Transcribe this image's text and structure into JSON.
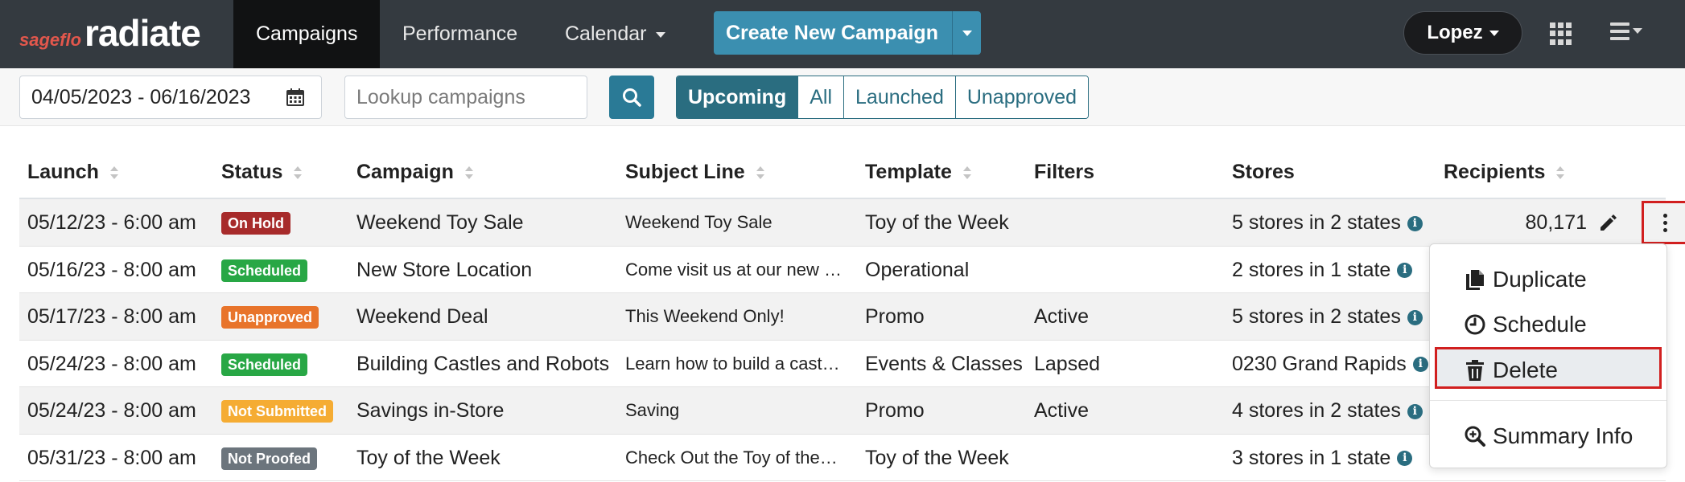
{
  "brand": {
    "small": "sageflo",
    "big": "radiate"
  },
  "nav": {
    "campaigns": "Campaigns",
    "performance": "Performance",
    "calendar": "Calendar",
    "create": "Create New Campaign",
    "user": "Lopez"
  },
  "toolbar": {
    "date_range": "04/05/2023 - 06/16/2023",
    "search_placeholder": "Lookup campaigns",
    "filters": [
      "Upcoming",
      "All",
      "Launched",
      "Unapproved"
    ],
    "active_filter": "Upcoming"
  },
  "table": {
    "headers": {
      "launch": "Launch",
      "status": "Status",
      "campaign": "Campaign",
      "subject": "Subject Line",
      "template": "Template",
      "filters": "Filters",
      "stores": "Stores",
      "recipients": "Recipients"
    },
    "rows": [
      {
        "launch": "05/12/23 - 6:00 am",
        "status": "On Hold",
        "status_color": "#a72b2b",
        "campaign": "Weekend Toy Sale",
        "subject": "Weekend Toy Sale",
        "template": "Toy of the Week",
        "filters": "",
        "stores": "5 stores in 2 states",
        "recipients": "80,171"
      },
      {
        "launch": "05/16/23 - 8:00 am",
        "status": "Scheduled",
        "status_color": "#28a745",
        "campaign": "New Store Location",
        "subject": "Come visit us at our new …",
        "template": "Operational",
        "filters": "",
        "stores": "2 stores in 1 state",
        "recipients": ""
      },
      {
        "launch": "05/17/23 - 8:00 am",
        "status": "Unapproved",
        "status_color": "#e8742b",
        "campaign": "Weekend Deal",
        "subject": "This Weekend Only!",
        "template": "Promo",
        "filters": "Active",
        "stores": "5 stores in 2 states",
        "recipients": ""
      },
      {
        "launch": "05/24/23 - 8:00 am",
        "status": "Scheduled",
        "status_color": "#28a745",
        "campaign": "Building Castles and Robots",
        "subject": "Learn how to build a cast…",
        "template": "Events & Classes",
        "filters": "Lapsed",
        "stores": "0230 Grand Rapids",
        "recipients": ""
      },
      {
        "launch": "05/24/23 - 8:00 am",
        "status": "Not Submitted",
        "status_color": "#f5ac33",
        "campaign": "Savings in-Store",
        "subject": "Saving",
        "template": "Promo",
        "filters": "Active",
        "stores": "4 stores in 2 states",
        "recipients": ""
      },
      {
        "launch": "05/31/23 - 8:00 am",
        "status": "Not Proofed",
        "status_color": "#6c757d",
        "campaign": "Toy of the Week",
        "subject": "Check Out the Toy of the…",
        "template": "Toy of the Week",
        "filters": "",
        "stores": "3 stores in 1 state",
        "recipients": ""
      }
    ]
  },
  "dropdown": {
    "duplicate": "Duplicate",
    "schedule": "Schedule",
    "delete": "Delete",
    "summary": "Summary Info"
  },
  "colors": {
    "navbar": "#343a40",
    "accent": "#2a6d80",
    "highlight": "#d11f1f"
  },
  "icons": [
    "calendar-icon",
    "search-icon",
    "grid-icon",
    "hamburger-icon",
    "info-icon",
    "pencil-icon",
    "kebab-icon",
    "copy-icon",
    "clock-icon",
    "trash-icon",
    "zoom-icon"
  ]
}
